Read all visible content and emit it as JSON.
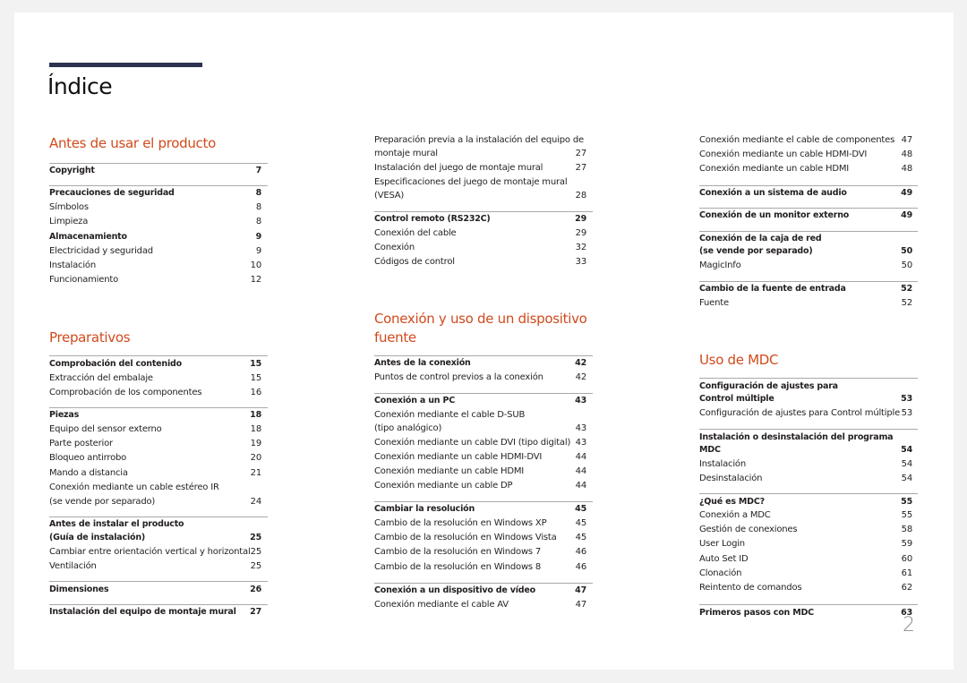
{
  "title": "Índice",
  "page_number": "2",
  "colors": {
    "heading": "#d04a1c",
    "bar": "#2c3250",
    "rule": "#a9a9a9"
  },
  "col1": {
    "sections": [
      {
        "heading": "Antes de usar el producto"
      },
      {
        "heading": "Preparativos"
      }
    ],
    "rows": [
      {
        "label": "Copyright",
        "page": "7",
        "bold": true
      },
      {
        "label": "Precauciones de seguridad",
        "page": "8",
        "bold": true
      },
      {
        "label": "Símbolos",
        "page": "8"
      },
      {
        "label": "Limpieza",
        "page": "8"
      },
      {
        "label": "Almacenamiento",
        "page": "9",
        "bold": true
      },
      {
        "label": "Electricidad y seguridad",
        "page": "9"
      },
      {
        "label": "Instalación",
        "page": "10"
      },
      {
        "label": "Funcionamiento",
        "page": "12"
      },
      {
        "label": "Comprobación del contenido",
        "page": "15",
        "bold": true
      },
      {
        "label": "Extracción del embalaje",
        "page": "15"
      },
      {
        "label": "Comprobación de los componentes",
        "page": "16"
      },
      {
        "label": "Piezas",
        "page": "18",
        "bold": true
      },
      {
        "label": "Equipo del sensor externo",
        "page": "18"
      },
      {
        "label": "Parte posterior",
        "page": "19"
      },
      {
        "label": "Bloqueo antirrobo",
        "page": "20"
      },
      {
        "label": "Mando a distancia",
        "page": "21"
      },
      {
        "label": "Conexión mediante un cable estéreo IR",
        "page": ""
      },
      {
        "label": "(se vende por separado)",
        "page": "24"
      },
      {
        "label": "Antes de instalar el producto",
        "page": "",
        "bold": true
      },
      {
        "label": "(Guía de instalación)",
        "page": "25",
        "bold": true
      },
      {
        "label": "Cambiar entre orientación vertical y horizontal",
        "page": "25"
      },
      {
        "label": "Ventilación",
        "page": "25"
      },
      {
        "label": "Dimensiones",
        "page": "26",
        "bold": true
      },
      {
        "label": "Instalación del equipo de montaje mural",
        "page": "27",
        "bold": true
      }
    ]
  },
  "col2": {
    "sections": [
      {
        "heading_line1": "Conexión y uso de un dispositivo",
        "heading_line2": "fuente"
      }
    ],
    "rows": [
      {
        "label": "Preparación previa a la instalación del equipo de",
        "page": ""
      },
      {
        "label": "montaje mural",
        "page": "27"
      },
      {
        "label": "Instalación del juego de montaje mural",
        "page": "27"
      },
      {
        "label": "Especificaciones del juego de montaje mural",
        "page": ""
      },
      {
        "label": "(VESA)",
        "page": "28"
      },
      {
        "label": "Control remoto (RS232C)",
        "page": "29",
        "bold": true
      },
      {
        "label": "Conexión del cable",
        "page": "29"
      },
      {
        "label": "Conexión",
        "page": "32"
      },
      {
        "label": "Códigos de control",
        "page": "33"
      },
      {
        "label": "Antes de la conexión",
        "page": "42",
        "bold": true
      },
      {
        "label": "Puntos de control previos a la conexión",
        "page": "42"
      },
      {
        "label": "Conexión a un PC",
        "page": "43",
        "bold": true
      },
      {
        "label": "Conexión mediante el cable D-SUB",
        "page": ""
      },
      {
        "label": "(tipo analógico)",
        "page": "43"
      },
      {
        "label": "Conexión mediante un cable DVI (tipo digital)",
        "page": "43"
      },
      {
        "label": "Conexión mediante un cable HDMI-DVI",
        "page": "44"
      },
      {
        "label": "Conexión mediante un cable HDMI",
        "page": "44"
      },
      {
        "label": "Conexión mediante un cable DP",
        "page": "44"
      },
      {
        "label": "Cambiar la resolución",
        "page": "45",
        "bold": true
      },
      {
        "label": "Cambio de la resolución en Windows XP",
        "page": "45"
      },
      {
        "label": "Cambio de la resolución en Windows Vista",
        "page": "45"
      },
      {
        "label": "Cambio de la resolución en Windows 7",
        "page": "46"
      },
      {
        "label": "Cambio de la resolución en Windows 8",
        "page": "46"
      },
      {
        "label": "Conexión a un dispositivo de vídeo",
        "page": "47",
        "bold": true
      },
      {
        "label": "Conexión mediante el cable AV",
        "page": "47"
      }
    ]
  },
  "col3": {
    "sections": [
      {
        "heading": "Uso de MDC"
      }
    ],
    "rows": [
      {
        "label": "Conexión mediante el cable de componentes",
        "page": "47"
      },
      {
        "label": "Conexión mediante un cable HDMI-DVI",
        "page": "48"
      },
      {
        "label": "Conexión mediante un cable HDMI",
        "page": "48"
      },
      {
        "label": "Conexión a un sistema de audio",
        "page": "49",
        "bold": true
      },
      {
        "label": "Conexión de un monitor externo",
        "page": "49",
        "bold": true
      },
      {
        "label": "Conexión de la caja de red",
        "page": "",
        "bold": true
      },
      {
        "label": "(se vende por separado)",
        "page": "50",
        "bold": true
      },
      {
        "label": "MagicInfo",
        "page": "50"
      },
      {
        "label": "Cambio de la fuente de entrada",
        "page": "52",
        "bold": true
      },
      {
        "label": "Fuente",
        "page": "52"
      },
      {
        "label": "Configuración de ajustes para",
        "page": "",
        "bold": true
      },
      {
        "label": "Control múltiple",
        "page": "53",
        "bold": true
      },
      {
        "label": "Configuración de ajustes para Control múltiple",
        "page": "53"
      },
      {
        "label": "Instalación o desinstalación del programa",
        "page": "",
        "bold": true
      },
      {
        "label": "MDC",
        "page": "54",
        "bold": true
      },
      {
        "label": "Instalación",
        "page": "54"
      },
      {
        "label": "Desinstalación",
        "page": "54"
      },
      {
        "label": "¿Qué es MDC?",
        "page": "55",
        "bold": true
      },
      {
        "label": "Conexión a MDC",
        "page": "55"
      },
      {
        "label": "Gestión de conexiones",
        "page": "58"
      },
      {
        "label": "User Login",
        "page": "59"
      },
      {
        "label": "Auto Set ID",
        "page": "60"
      },
      {
        "label": "Clonación",
        "page": "61"
      },
      {
        "label": "Reintento de comandos",
        "page": "62"
      },
      {
        "label": "Primeros pasos con MDC",
        "page": "63",
        "bold": true
      }
    ]
  }
}
